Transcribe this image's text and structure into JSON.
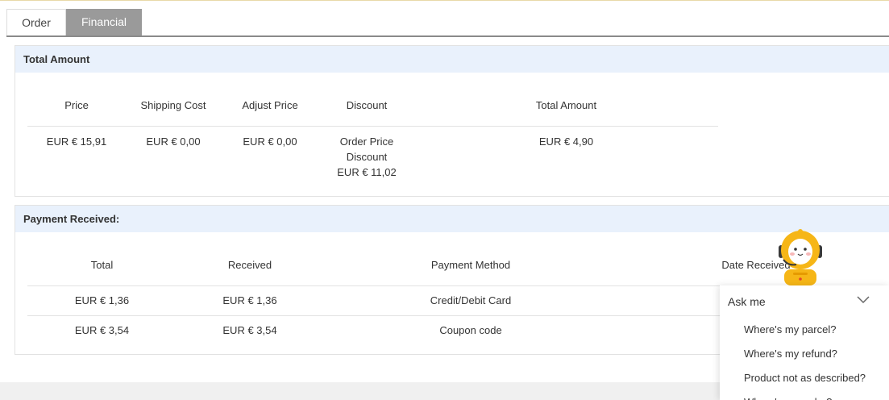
{
  "tabs": [
    {
      "label": "Order",
      "active": false
    },
    {
      "label": "Financial",
      "active": true
    }
  ],
  "total_amount": {
    "title": "Total Amount",
    "headers": [
      "Price",
      "Shipping Cost",
      "Adjust Price",
      "Discount",
      "Total Amount"
    ],
    "row": {
      "price": "EUR € 15,91",
      "shipping": "EUR € 0,00",
      "adjust": "EUR € 0,00",
      "discount_lines": [
        "Order Price",
        "Discount",
        "EUR € 11,02"
      ],
      "total": "EUR € 4,90"
    }
  },
  "payment_received": {
    "title": "Payment Received:",
    "headers": [
      "Total",
      "Received",
      "Payment Method",
      "Date Received"
    ],
    "rows": [
      {
        "total": "EUR € 1,36",
        "received": "EUR € 1,36",
        "method": "Credit/Debit Card"
      },
      {
        "total": "EUR € 3,54",
        "received": "EUR € 3,54",
        "method": "Coupon code"
      }
    ]
  },
  "chat": {
    "title": "Ask me",
    "items": [
      "Where's my parcel?",
      "Where's my refund?",
      "Product not as described?",
      "Where's my order?"
    ]
  },
  "colors": {
    "header_bg": "#e9f1fc",
    "active_tab": "#9a9a9a",
    "mascot": "#f6b617"
  }
}
